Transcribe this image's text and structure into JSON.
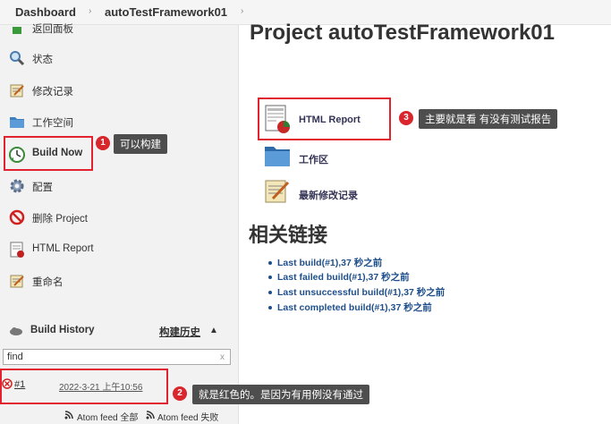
{
  "breadcrumb": {
    "dashboard": "Dashboard",
    "project": "autoTestFramework01"
  },
  "sidebar": {
    "items": [
      {
        "label": "返回面板"
      },
      {
        "label": "状态"
      },
      {
        "label": "修改记录"
      },
      {
        "label": "工作空间"
      },
      {
        "label": "Build Now"
      },
      {
        "label": "配置"
      },
      {
        "label": "删除 Project"
      },
      {
        "label": "HTML Report"
      },
      {
        "label": "重命名"
      }
    ]
  },
  "build_history": {
    "title": "Build History",
    "trend": "构建历史",
    "find_value": "find",
    "clear": "x",
    "builds": [
      {
        "number": "#1",
        "date": "2022-3-21 上午10:56"
      }
    ],
    "feed_all": "Atom feed 全部",
    "feed_fail": "Atom feed 失败"
  },
  "main": {
    "title": "Project autoTestFramework01",
    "links": [
      {
        "label": "HTML Report"
      },
      {
        "label": "工作区"
      },
      {
        "label": "最新修改记录"
      }
    ],
    "related_title": "相关链接",
    "related": [
      "Last build(#1),37 秒之前",
      "Last failed build(#1),37 秒之前",
      "Last unsuccessful build(#1),37 秒之前",
      "Last completed build(#1),37 秒之前"
    ]
  },
  "annotations": [
    {
      "num": "1",
      "text": "可以构建"
    },
    {
      "num": "2",
      "text": "就是红色的。是因为有用例没有通过"
    },
    {
      "num": "3",
      "text": "主要就是看 有没有测试报告"
    }
  ],
  "colors": {
    "annotation_red": "#e0232f",
    "link_blue": "#1e4f8c",
    "tooltip_bg": "#4e4e4e"
  }
}
